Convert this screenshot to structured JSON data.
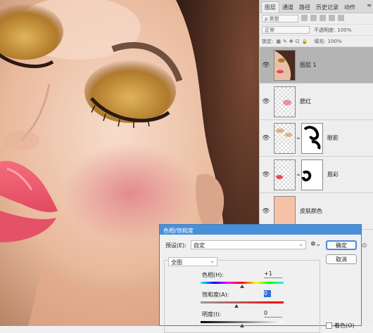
{
  "layers_panel": {
    "tabs": [
      "图层",
      "通道",
      "路径",
      "历史记录",
      "动作"
    ],
    "active_tab": "图层",
    "filter_kind": "ρ 类型",
    "blend_mode": "正常",
    "opacity_label": "不透明度:",
    "opacity_value": "100%",
    "lock_label": "锁定:",
    "fill_label": "填充:",
    "fill_value": "100%",
    "layers": [
      {
        "name": "图层 1",
        "selected": true
      },
      {
        "name": "腮红",
        "selected": false
      },
      {
        "name": "眼影",
        "selected": false
      },
      {
        "name": "唇彩",
        "selected": false
      },
      {
        "name": "皮肤颜色",
        "selected": false
      }
    ],
    "skin_swatch_color": "#f6c2a7"
  },
  "dialog": {
    "title": "色相/饱和度",
    "preset_label": "预设(E):",
    "preset_value": "自定",
    "ok_label": "确定",
    "cancel_label": "取消",
    "channel_value": "全图",
    "hue_label": "色相(H):",
    "hue_value": "+1",
    "saturation_label": "饱和度(A):",
    "saturation_value": "0",
    "lightness_label": "明度(I):",
    "lightness_value": "0",
    "colorize_label": "着色(O)"
  }
}
